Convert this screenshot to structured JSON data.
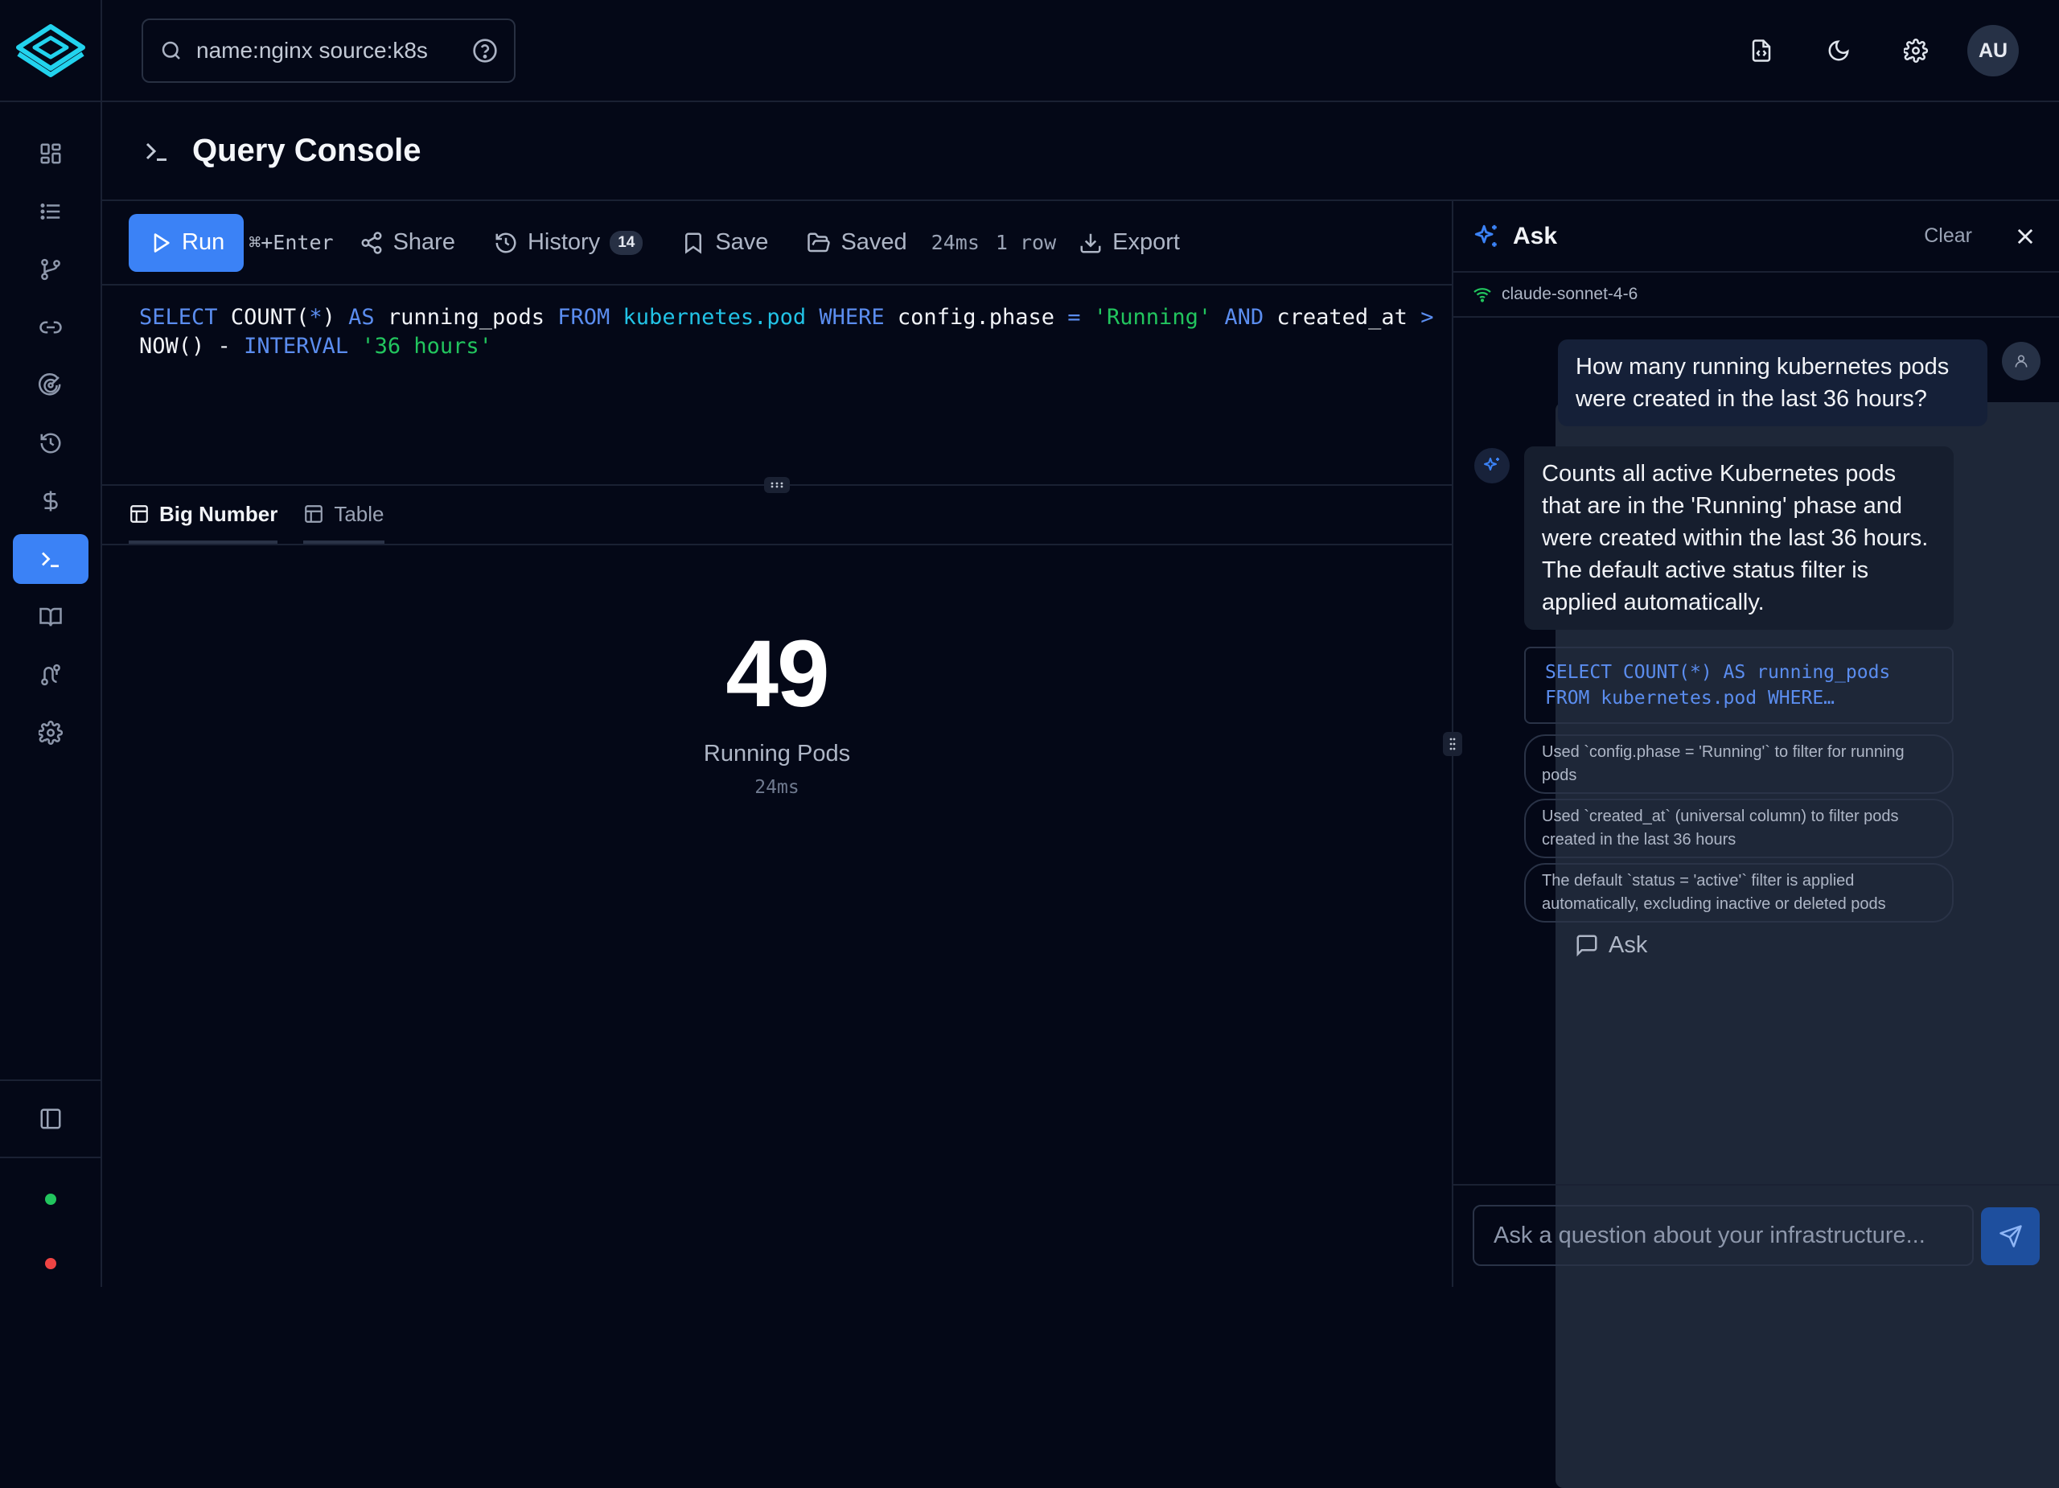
{
  "app": {
    "search_text": "name:nginx source:k8s",
    "user_initials": "AU"
  },
  "sidebar": {
    "items": [
      {
        "icon": "dashboard-icon"
      },
      {
        "icon": "list-icon"
      },
      {
        "icon": "git-branch-icon"
      },
      {
        "icon": "link-icon"
      },
      {
        "icon": "radar-icon"
      },
      {
        "icon": "history-icon"
      },
      {
        "icon": "dollar-icon"
      },
      {
        "icon": "terminal-icon",
        "active": true
      },
      {
        "icon": "book-icon"
      },
      {
        "icon": "route-icon"
      },
      {
        "icon": "settings-icon"
      }
    ],
    "status": [
      {
        "color": "#22c55e"
      },
      {
        "color": "#ef4444"
      }
    ]
  },
  "page": {
    "title": "Query Console"
  },
  "toolbar": {
    "run": "Run",
    "shortcut": "⌘+Enter",
    "share": "Share",
    "history": "History",
    "history_count": "14",
    "save": "Save",
    "saved": "Saved",
    "ask": "Ask",
    "time": "24ms",
    "rows": "1 row",
    "export": "Export"
  },
  "editor": {
    "tokens": [
      {
        "t": "SELECT",
        "c": "kw"
      },
      {
        "t": " ",
        "c": "id"
      },
      {
        "t": "COUNT(",
        "c": "id"
      },
      {
        "t": "*",
        "c": "kw"
      },
      {
        "t": ")",
        "c": "id"
      },
      {
        "t": " AS ",
        "c": "kw"
      },
      {
        "t": "running_pods",
        "c": "id"
      },
      {
        "t": " FROM ",
        "c": "kw"
      },
      {
        "t": "kubernetes.pod",
        "c": "tbl"
      },
      {
        "t": " WHERE ",
        "c": "kw"
      },
      {
        "t": "config.phase",
        "c": "id"
      },
      {
        "t": " = ",
        "c": "op"
      },
      {
        "t": "'Running'",
        "c": "str"
      },
      {
        "t": " AND ",
        "c": "kw"
      },
      {
        "t": "created_at",
        "c": "id"
      },
      {
        "t": " >",
        "c": "op"
      },
      {
        "t": "\n",
        "c": "br"
      },
      {
        "t": "NOW()",
        "c": "id"
      },
      {
        "t": " - ",
        "c": "id"
      },
      {
        "t": "INTERVAL",
        "c": "kw"
      },
      {
        "t": " ",
        "c": "id"
      },
      {
        "t": "'36 hours'",
        "c": "str"
      }
    ]
  },
  "results": {
    "tabs": [
      {
        "label": "Big Number",
        "active": true
      },
      {
        "label": "Table",
        "active": false
      }
    ],
    "value": "49",
    "label": "Running Pods",
    "time": "24ms"
  },
  "ask": {
    "title": "Ask",
    "clear": "Clear",
    "model": "claude-sonnet-4-6",
    "user_message": "How many running kubernetes pods were created in the last 36 hours?",
    "bot_message": "Counts all active Kubernetes pods that are in the 'Running' phase and were created within the last 36 hours. The default active status filter is applied automatically.",
    "sql_line1": "SELECT COUNT(*) AS running_pods",
    "sql_line2": "FROM kubernetes.pod WHERE…",
    "notes": [
      "Used `config.phase = 'Running'` to filter for running pods",
      "Used `created_at` (universal column) to filter pods created in the last 36 hours",
      "The default `status = 'active'` filter is applied automatically, excluding inactive or deleted pods"
    ],
    "input_placeholder": "Ask a question about your infrastructure..."
  },
  "colors": {
    "accent": "#3b82f6",
    "background": "#040817",
    "string": "#22c55e",
    "table": "#22c3e6"
  }
}
